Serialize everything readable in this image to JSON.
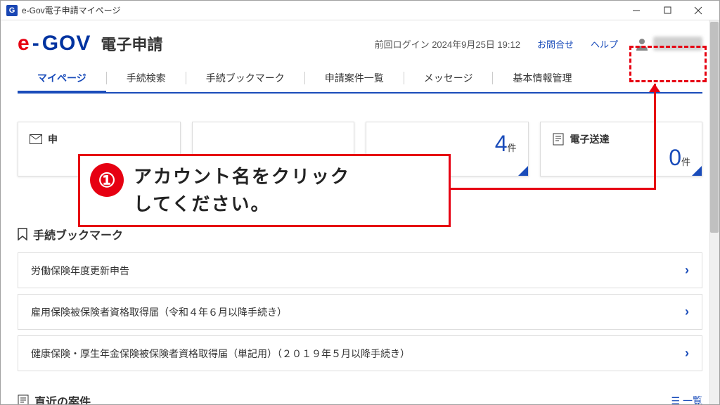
{
  "window": {
    "title": "e-Gov電子申請マイページ"
  },
  "logo": {
    "e": "e",
    "dash": "-",
    "gov": "GOV",
    "sub": "電子申請"
  },
  "header": {
    "last_login_label": "前回ログイン",
    "last_login_time": "2024年9月25日 19:12",
    "contact": "お問合せ",
    "help": "ヘルプ"
  },
  "nav": [
    {
      "label": "マイページ",
      "active": true
    },
    {
      "label": "手続検索",
      "active": false
    },
    {
      "label": "手続ブックマーク",
      "active": false
    },
    {
      "label": "申請案件一覧",
      "active": false
    },
    {
      "label": "メッセージ",
      "active": false
    },
    {
      "label": "基本情報管理",
      "active": false
    }
  ],
  "cards": [
    {
      "title": "申",
      "value": "",
      "unit": ""
    },
    {
      "title": "",
      "value": "",
      "unit": ""
    },
    {
      "title": "",
      "value": "4",
      "unit": "件"
    },
    {
      "title": "電子送達",
      "value": "0",
      "unit": "件"
    }
  ],
  "callout": {
    "number": "①",
    "text_line1": "アカウント名をクリック",
    "text_line2": "してください。"
  },
  "bookmark_section": {
    "title": "手続ブックマーク"
  },
  "bookmarks": [
    {
      "label": "労働保険年度更新申告"
    },
    {
      "label": "雇用保険被保険者資格取得届（令和４年６月以降手続き）"
    },
    {
      "label": "健康保険・厚生年金保険被保険者資格取得届（単記用）（２０１９年５月以降手続き）"
    }
  ],
  "recent_section": {
    "title": "直近の案件",
    "list_link": "一覧"
  }
}
